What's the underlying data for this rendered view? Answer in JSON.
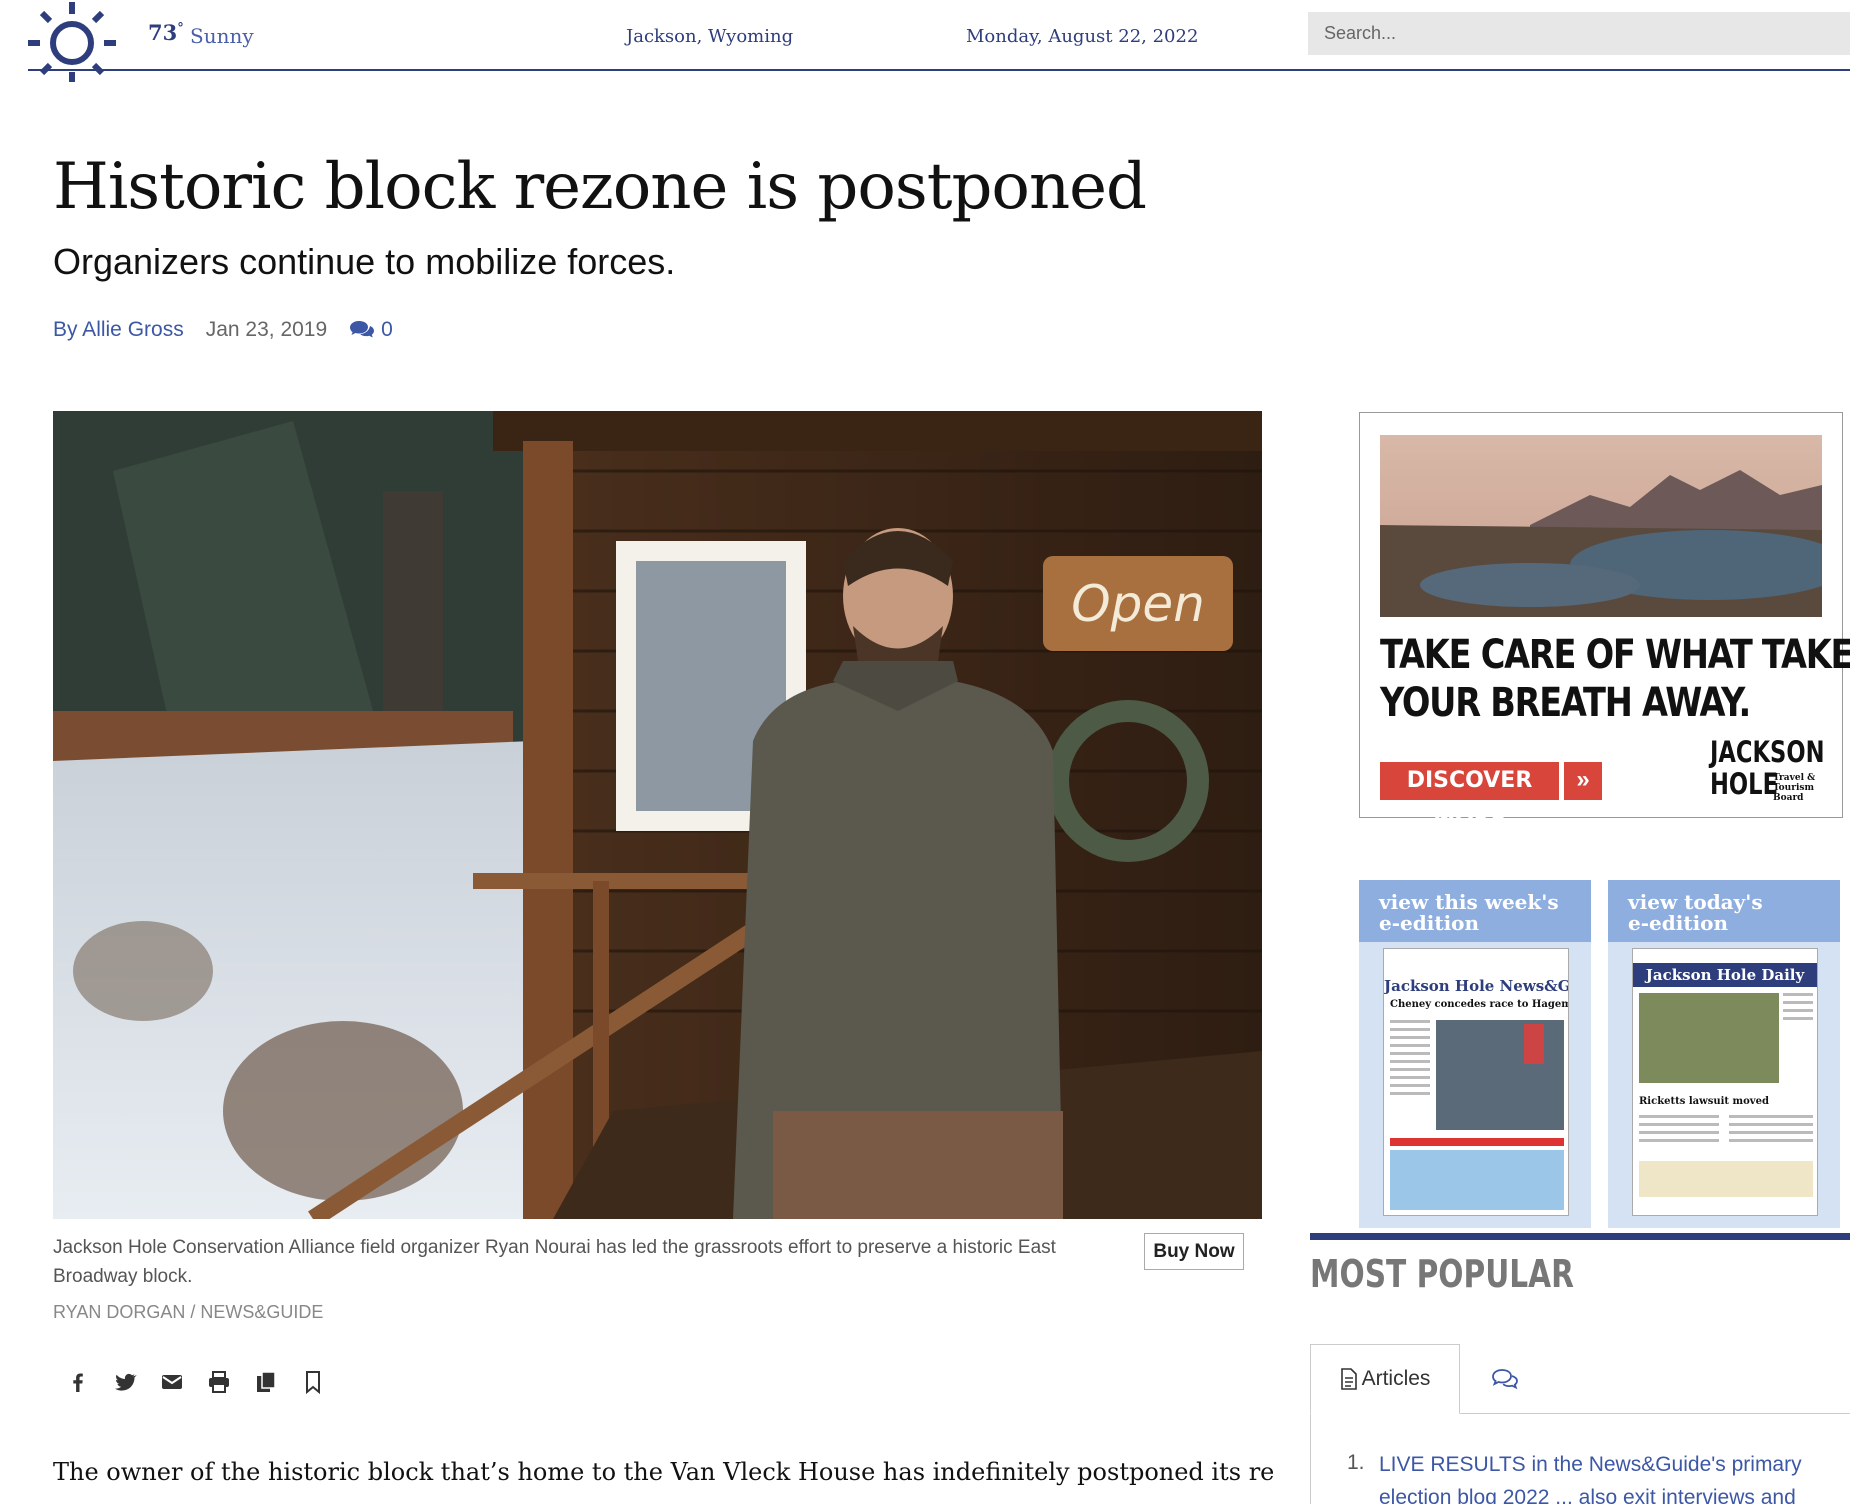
{
  "topbar": {
    "weather_icon": "sun-icon",
    "temperature": "73",
    "degree": "°",
    "condition": "Sunny",
    "location": "Jackson, Wyoming",
    "date": "Monday, August 22, 2022",
    "search_placeholder": "Search..."
  },
  "article": {
    "headline": "Historic block rezone is postponed",
    "subhead": "Organizers continue to mobilize forces.",
    "author": "By Allie Gross",
    "published": "Jan 23, 2019",
    "comment_count": "0",
    "photo_sign_text": "Open",
    "caption": "Jackson Hole Conservation Alliance field organizer Ryan Nourai has led the grassroots effort to preserve a historic East Broadway block.",
    "buy_now": "Buy Now",
    "credit": "RYAN DORGAN / NEWS&GUIDE",
    "share_icons": [
      "facebook-icon",
      "twitter-icon",
      "email-icon",
      "print-icon",
      "copy-icon",
      "bookmark-icon"
    ],
    "body_first_line": "The owner of the historic block that’s home to the Van Vleck House has indefinitely postponed its request"
  },
  "sidebar": {
    "ad": {
      "headline_line1": "TAKE CARE OF WHAT TAKES",
      "headline_line2": "YOUR BREATH AWAY.",
      "button": "DISCOVER MORE",
      "button_arrow": "»",
      "logo_line1": "JACKSON",
      "logo_line2": "HOLE",
      "logo_sub": "Travel & Tourism Board"
    },
    "eeditions": [
      {
        "label_line1": "view this week's",
        "label_line2": "e-edition",
        "paper": "Jackson Hole News&Guide",
        "headline": "Cheney concedes race to Hageman"
      },
      {
        "label_line1": "view today's",
        "label_line2": "e-edition",
        "paper": "Jackson Hole Daily",
        "headline": "Ricketts lawsuit moved"
      }
    ],
    "most_popular": {
      "title": "MOST POPULAR",
      "tab_articles": "Articles",
      "tab_comments_icon": "comments-icon",
      "items": [
        {
          "num": "1.",
          "text": "LIVE RESULTS in the News&Guide's primary election blog 2022 ... also exit interviews and"
        }
      ]
    }
  },
  "colors": {
    "brand_navy": "#2e3d7c",
    "link_blue": "#3c57a6",
    "ad_red": "#d8453a",
    "eedition_blue": "#8faee0"
  }
}
